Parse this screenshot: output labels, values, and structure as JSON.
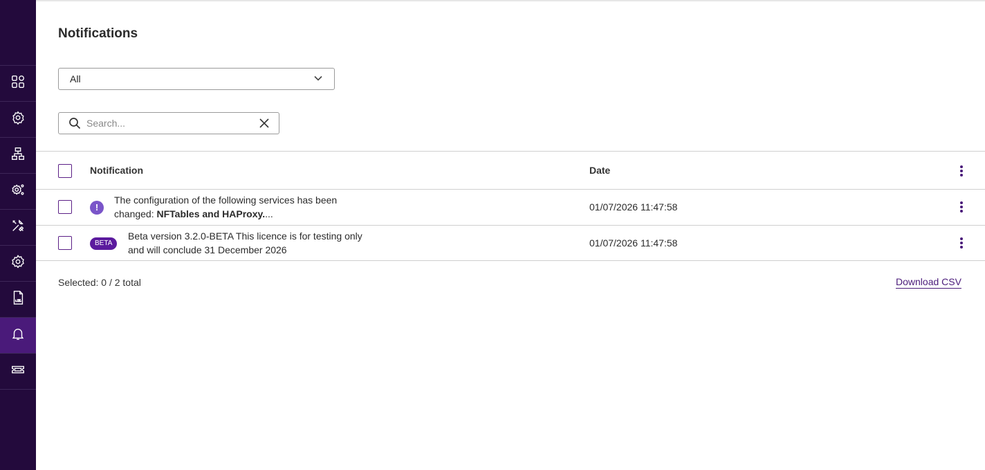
{
  "sidebar": {
    "items": [
      {
        "name": "dashboard-icon"
      },
      {
        "name": "services-icon"
      },
      {
        "name": "network-icon"
      },
      {
        "name": "advanced-settings-icon"
      },
      {
        "name": "tools-icon"
      },
      {
        "name": "settings-icon"
      },
      {
        "name": "log-file-icon"
      },
      {
        "name": "bell-icon",
        "active": true
      },
      {
        "name": "ticket-icon"
      }
    ],
    "active_color": "#4a1a7a",
    "background_color": "#230a3c"
  },
  "page": {
    "title": "Notifications"
  },
  "filter": {
    "selected": "All"
  },
  "search": {
    "placeholder": "Search...",
    "value": ""
  },
  "table": {
    "columns": {
      "notification": "Notification",
      "date": "Date"
    },
    "rows": [
      {
        "icon": "alert-icon",
        "icon_glyph": "!",
        "text_prefix": "The configuration of the following services has been changed: ",
        "text_bold": "NFTables and HAProxy.",
        "text_suffix": "...",
        "date": "01/07/2026 11:47:58"
      },
      {
        "badge": "BETA",
        "text": "Beta version 3.2.0-BETA This licence is for testing only and will conclude 31 December 2026",
        "date": "01/07/2026 11:47:58"
      }
    ]
  },
  "footer": {
    "selected_text": "Selected: 0 / 2 total",
    "download_label": "Download CSV"
  },
  "colors": {
    "accent": "#5b1f86",
    "alert_icon": "#7a55c9",
    "beta_badge": "#5b1a9e"
  }
}
